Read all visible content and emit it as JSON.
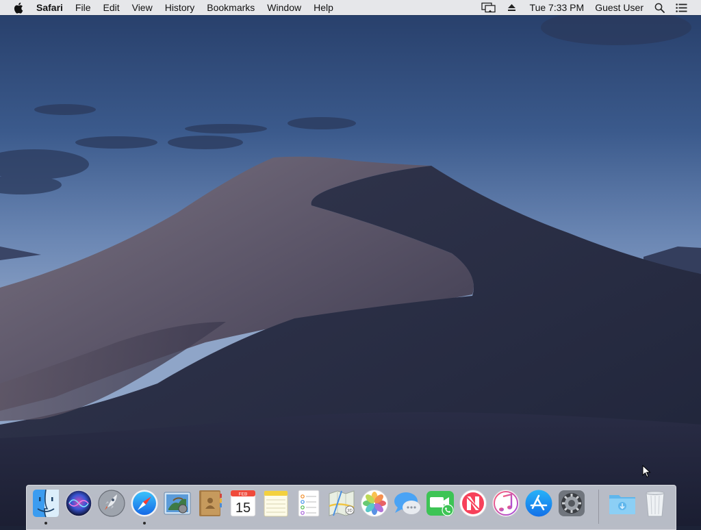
{
  "colors": {
    "menubar_bg": "#ececee",
    "sky_top": "#27406c",
    "sky_horizon": "#7c95be",
    "dune_light": "#6f6a7a",
    "dune_shadow": "#232841",
    "dock_bg": "#d2d6de"
  },
  "menubar": {
    "apple_icon": "apple-logo-icon",
    "app_name": "Safari",
    "menus": [
      "File",
      "Edit",
      "View",
      "History",
      "Bookmarks",
      "Window",
      "Help"
    ],
    "status": {
      "display_icon": "airplay-display-icon",
      "eject_icon": "eject-icon",
      "clock": "Tue 7:33 PM",
      "user": "Guest User",
      "spotlight_icon": "spotlight-search-icon",
      "notification_icon": "notification-center-icon"
    }
  },
  "dock": {
    "apps": [
      {
        "name": "Finder",
        "icon": "finder-icon",
        "running": true
      },
      {
        "name": "Siri",
        "icon": "siri-icon",
        "running": false
      },
      {
        "name": "Launchpad",
        "icon": "launchpad-icon",
        "running": false
      },
      {
        "name": "Safari",
        "icon": "safari-icon",
        "running": true
      },
      {
        "name": "Mail",
        "icon": "mail-icon",
        "running": false
      },
      {
        "name": "Contacts",
        "icon": "contacts-icon",
        "running": false
      },
      {
        "name": "Calendar",
        "icon": "calendar-icon",
        "running": false
      },
      {
        "name": "Notes",
        "icon": "notes-icon",
        "running": false
      },
      {
        "name": "Reminders",
        "icon": "reminders-icon",
        "running": false
      },
      {
        "name": "Maps",
        "icon": "maps-icon",
        "running": false
      },
      {
        "name": "Photos",
        "icon": "photos-icon",
        "running": false
      },
      {
        "name": "Messages",
        "icon": "messages-icon",
        "running": false
      },
      {
        "name": "FaceTime",
        "icon": "facetime-icon",
        "running": false
      },
      {
        "name": "News",
        "icon": "news-icon",
        "running": false
      },
      {
        "name": "iTunes",
        "icon": "itunes-icon",
        "running": false
      },
      {
        "name": "App Store",
        "icon": "app-store-icon",
        "running": false
      },
      {
        "name": "System Preferences",
        "icon": "system-preferences-icon",
        "running": false
      }
    ],
    "calendar_month": "FEB",
    "calendar_day": "15",
    "stacks": [
      {
        "name": "Downloads",
        "icon": "downloads-folder-icon"
      },
      {
        "name": "Trash",
        "icon": "trash-icon"
      }
    ]
  }
}
